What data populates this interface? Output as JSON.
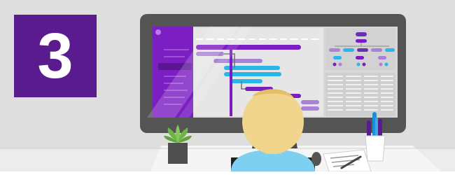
{
  "badge": {
    "number": "3",
    "color": "#5a1b8e"
  },
  "colors": {
    "wall": "#dedede",
    "desk": "#f4f4f4",
    "monitor_frame": "#545454",
    "screen": "#d8d8d8",
    "sidebar": "#7b1fc2",
    "gantt_purple": "#7a1ec1",
    "gantt_lilac": "#a982d6",
    "gantt_cyan": "#2bb6ea",
    "org_purple": "#6a2fb8",
    "hair": "#f2d58c",
    "shirt": "#7fcff0",
    "plant": "#6fb546",
    "pen_blue": "#1d8fd6",
    "pen_purple": "#5a1b8e"
  },
  "icons": [
    "monitor-icon",
    "plant-icon",
    "pen-cup-icon",
    "mouse-icon",
    "document-icon",
    "person-icon"
  ]
}
